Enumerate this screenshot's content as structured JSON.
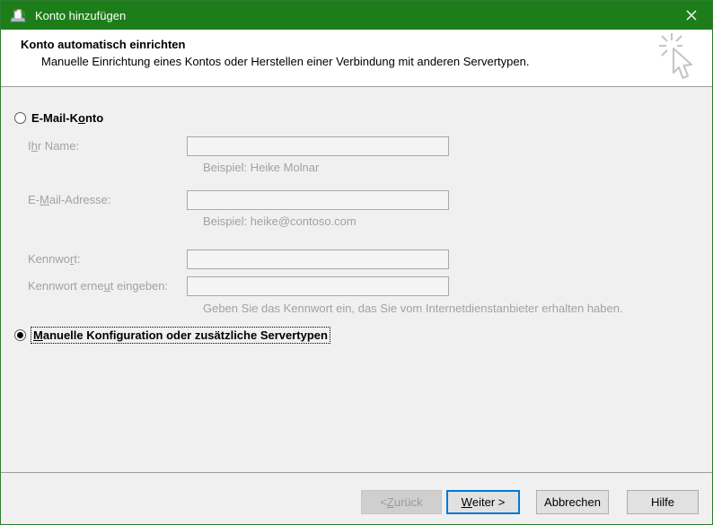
{
  "window": {
    "title": "Konto hinzufügen"
  },
  "header": {
    "title": "Konto automatisch einrichten",
    "subtitle": "Manuelle Einrichtung eines Kontos oder Herstellen einer Verbindung mit anderen Servertypen."
  },
  "form": {
    "email_account_radio": {
      "pre": "E-Mail-K",
      "key": "o",
      "post": "nto",
      "selected": false
    },
    "name_label": {
      "pre": "I",
      "key": "h",
      "post": "r Name:"
    },
    "name_example": "Beispiel: Heike Molnar",
    "email_label": {
      "pre": "E-",
      "key": "M",
      "post": "ail-Adresse:"
    },
    "email_example": "Beispiel: heike@contoso.com",
    "password_label": {
      "pre": "Kennwo",
      "key": "r",
      "post": "t:"
    },
    "password_retype_label": {
      "pre": "Kennwort erne",
      "key": "u",
      "post": "t eingeben:"
    },
    "password_hint": "Geben Sie das Kennwort ein, das Sie vom Internetdienstanbieter erhalten haben.",
    "manual_config_radio": {
      "pre": "",
      "key": "M",
      "post": "anuelle Konfiguration oder zusätzliche Servertypen",
      "selected": true
    },
    "inputs": {
      "name_value": "",
      "email_value": "",
      "password_value": "",
      "password_retype_value": ""
    }
  },
  "footer": {
    "back_button": {
      "pre": "< ",
      "key": "Z",
      "post": "urück",
      "enabled": false
    },
    "next_button": {
      "pre": "",
      "key": "W",
      "post": "eiter >",
      "enabled": true
    },
    "cancel_button": "Abbrechen",
    "help_button": "Hilfe"
  },
  "colors": {
    "titlebar_green": "#1d7d18",
    "window_border_green": "#2d7d2d",
    "default_button_border": "#0078d7",
    "disabled_text": "#a2a2a2"
  }
}
